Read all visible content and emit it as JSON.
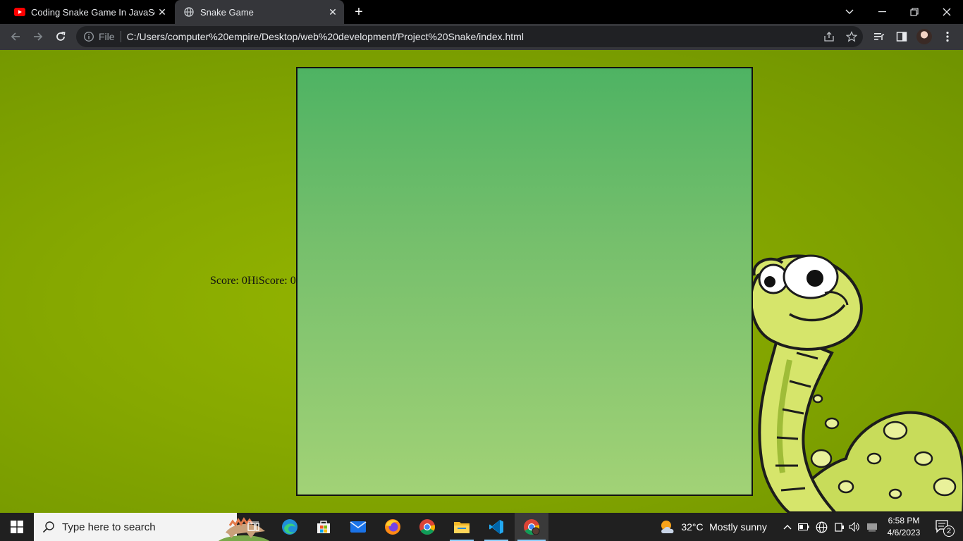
{
  "browser": {
    "tabs": [
      {
        "title": "Coding Snake Game In JavaScrip",
        "favicon": "youtube-icon",
        "active": false
      },
      {
        "title": "Snake Game",
        "favicon": "globe-icon",
        "active": true
      }
    ],
    "address": {
      "scheme_label": "File",
      "url": "C:/Users/computer%20empire/Desktop/web%20development/Project%20Snake/index.html"
    }
  },
  "game": {
    "score_label": "Score: 0",
    "hiscore_label": "HiScore: 0"
  },
  "taskbar": {
    "search_placeholder": "Type here to search",
    "weather_temp": "32°C",
    "weather_desc": "Mostly sunny",
    "time": "6:58 PM",
    "date": "4/6/2023",
    "notification_count": "2"
  },
  "colors": {
    "page_bg": "#86a800",
    "board_top": "#4eb363",
    "board_bottom": "#a2d276",
    "tab_active": "#35363a"
  }
}
